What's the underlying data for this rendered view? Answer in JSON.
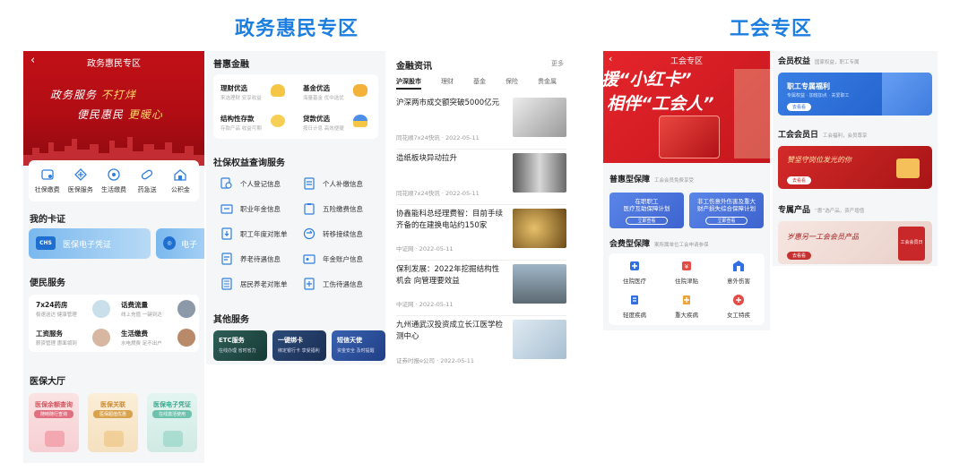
{
  "titles": {
    "left": "政务惠民专区",
    "right": "工会专区"
  },
  "colors": {
    "accent": "#1c7fe0",
    "red": "#c11017",
    "blue": "#3d63cf"
  },
  "p1": {
    "back_icon": "chevron-left-icon",
    "header_title": "政务惠民专区",
    "slogan1_a": "政务服务",
    "slogan1_b": "不打烊",
    "slogan2_a": "便民惠民",
    "slogan2_b": "更暖心",
    "quick": [
      {
        "label": "社保缴费",
        "icon": "shebao-icon"
      },
      {
        "label": "医保服务",
        "icon": "yibao-icon"
      },
      {
        "label": "生活缴费",
        "icon": "life-pay-icon"
      },
      {
        "label": "药急送",
        "icon": "pill-icon"
      },
      {
        "label": "公积金",
        "icon": "house-icon"
      }
    ],
    "my_cards": "我的卡证",
    "card1": "医保电子凭证",
    "card1_logo": "CHS",
    "card2": "电子",
    "convenience": "便民服务",
    "services": [
      {
        "title": "7x24药房",
        "sub": "极速送达 健康管理"
      },
      {
        "title": "话费流量",
        "sub": "线上充值 一键到达"
      },
      {
        "title": "工资服务",
        "sub": "薪资管理 惠面領到"
      },
      {
        "title": "生活缴费",
        "sub": "水电燃费 足不出户"
      }
    ],
    "hall": "医保大厅",
    "halls": [
      {
        "title": "医保余额查询",
        "sub": "随時随行查询"
      },
      {
        "title": "医保关联",
        "sub": "医保超值优惠"
      },
      {
        "title": "医保电子凭证",
        "sub": "在线激活使用"
      }
    ]
  },
  "p2": {
    "finance_title": "普惠金融",
    "fin": [
      {
        "title": "理财优选",
        "sub": "来选理财 安享收益"
      },
      {
        "title": "基金优选",
        "sub": "海量基金 优中选优"
      },
      {
        "title": "结构性存款",
        "sub": "存款产品 收益可期"
      },
      {
        "title": "贷款优选",
        "sub": "按日计息 高效便捷"
      }
    ],
    "query_title": "社保权益查询服务",
    "queries": [
      "个人登记信息",
      "个人补缴信息",
      "职业年金信息",
      "五险缴费信息",
      "职工年度对账单",
      "转移接续信息",
      "养老待遇信息",
      "年金账户信息",
      "居民养老对账单",
      "工伤待遇信息"
    ],
    "other_title": "其他服务",
    "others": [
      {
        "title": "ETC服务",
        "sub": "在线办理 省时省力"
      },
      {
        "title": "一键绑卡",
        "sub": "绑定银行卡 享受福利"
      },
      {
        "title": "短信天使",
        "sub": "资金安全 及时提醒"
      }
    ]
  },
  "p3": {
    "title": "金融资讯",
    "more": "更多",
    "tabs": [
      "沪深股市",
      "理财",
      "基金",
      "保险",
      "贵金属"
    ],
    "news": [
      {
        "title": "沪深两市成交额突破5000亿元",
        "meta": "同花顺7x24快讯 · 2022-05-11",
        "img": "what's next"
      },
      {
        "title": "造纸板块异动拉升",
        "meta": "同花顺7x24快讯 · 2022-05-11",
        "img": "paper roll"
      },
      {
        "title": "协鑫能科总经理费智：目前手续齐备的在建换电站约150家",
        "meta": "中证网 · 2022-05-11",
        "img": "gold"
      },
      {
        "title": "保利发展：2022年挖掘结构性机会 向管理要效益",
        "meta": "中证网 · 2022-05-11",
        "img": "construction"
      },
      {
        "title": "九州通武汉投资成立长江医学检测中心",
        "meta": "证券时报e公司 · 2022-05-11",
        "img": "lab"
      }
    ]
  },
  "p4": {
    "header_title": "工会专区",
    "slogan1": "援“小红卡”",
    "slogan2": "相伴“工会人”",
    "pubu_title": "普惠型保障",
    "pubu_sub": "工会会员免费享受",
    "pubu": [
      {
        "title": "在职职工\n医疗互助保障计划",
        "btn": "立即查看"
      },
      {
        "title": "非工伤意外伤害及重大\n财产损失综合保障计划",
        "btn": "立即查看"
      }
    ],
    "fee_title": "会费型保障",
    "fee_sub": "案所属单位工会申请参保",
    "fee": [
      {
        "label": "住院医疗",
        "icon": "hospital-icon"
      },
      {
        "label": "住院津贴",
        "icon": "allowance-icon"
      },
      {
        "label": "意外伤害",
        "icon": "accident-icon"
      },
      {
        "label": "轻度疾病",
        "icon": "mild-illness-icon"
      },
      {
        "label": "重大疾病",
        "icon": "major-illness-icon"
      },
      {
        "label": "女工特疾",
        "icon": "female-icon"
      }
    ]
  },
  "p5": {
    "rights_title": "会员权益",
    "rights_sub": "国家权益，职工专属",
    "rights_banner": "职工专属福利",
    "rights_banner_sub": "专属权益 · 加班加点 · 关爱职工",
    "rights_btn": "去看看",
    "day_title": "工会会员日",
    "day_sub": "工会福利，会员尊享",
    "day_banner": "赞坚守岗位发光的你",
    "day_btn": "去看看",
    "excl_title": "专属产品",
    "excl_sub": "“惠”选产品，资产增值",
    "excl_banner": "岁惠另一工会会员产品",
    "excl_btn": "去看看",
    "excl_badge": "工会会员日"
  }
}
